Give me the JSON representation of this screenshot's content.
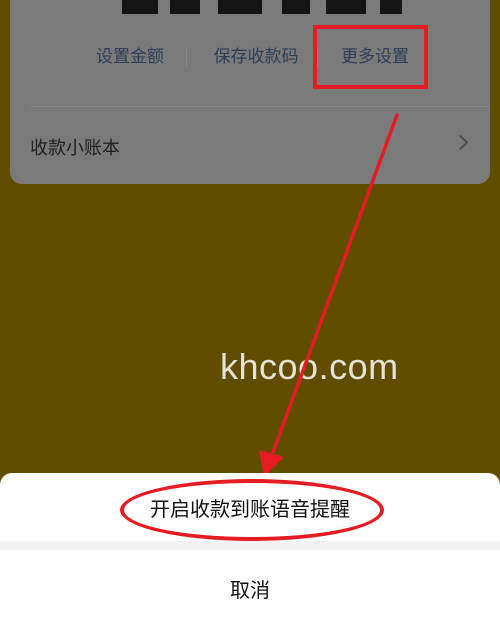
{
  "card": {
    "actions": [
      {
        "label": "设置金额"
      },
      {
        "label": "保存收款码"
      },
      {
        "label": "更多设置"
      }
    ],
    "ledger_label": "收款小账本",
    "chevron_icon": "chevron-right-icon"
  },
  "watermark": "khcoo.com",
  "sheet": {
    "option_label": "开启收款到账语音提醒",
    "cancel_label": "取消"
  },
  "colors": {
    "overlay_tint": "#614d00",
    "annotation_red": "#e51c23",
    "sheet_bg": "#ffffff"
  }
}
